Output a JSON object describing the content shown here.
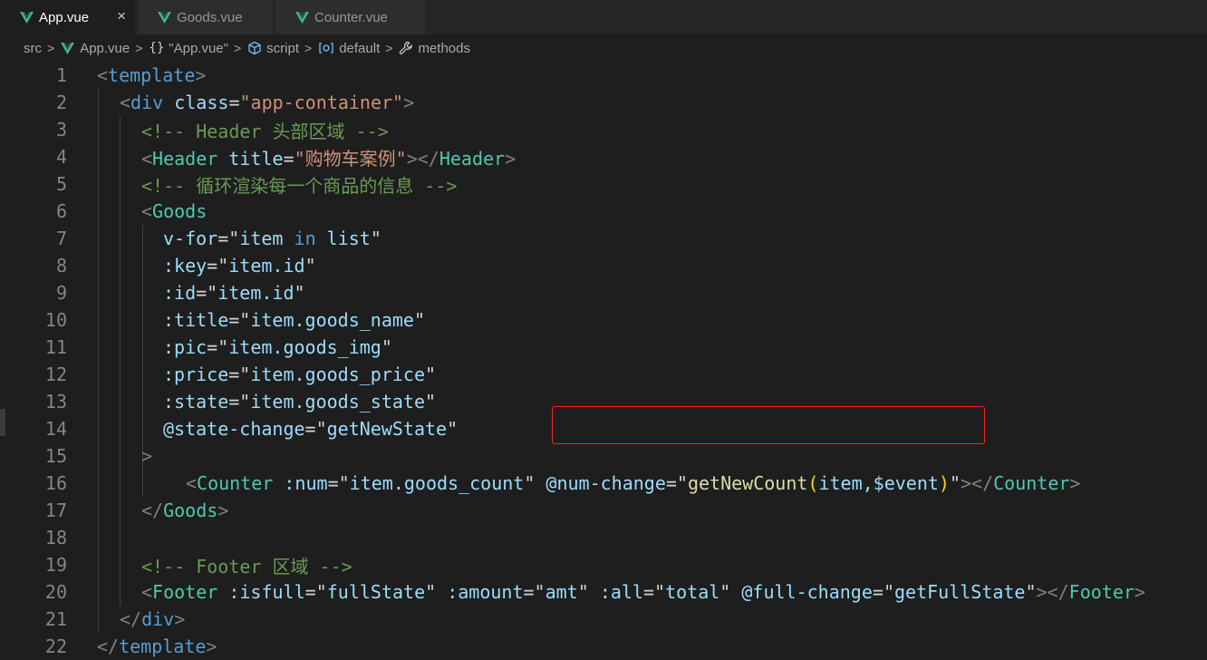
{
  "tabs": [
    {
      "label": "App.vue",
      "active": true,
      "close": "×"
    },
    {
      "label": "Goods.vue",
      "active": false
    },
    {
      "label": "Counter.vue",
      "active": false
    }
  ],
  "breadcrumb": {
    "src": "src",
    "file": "App.vue",
    "braces": "{}",
    "object": "\"App.vue\"",
    "script": "script",
    "default": "default",
    "methods": "methods"
  },
  "line_numbers": [
    "1",
    "2",
    "3",
    "4",
    "5",
    "6",
    "7",
    "8",
    "9",
    "10",
    "11",
    "12",
    "13",
    "14",
    "15",
    "16",
    "17",
    "18",
    "19",
    "20",
    "21",
    "22"
  ],
  "code": {
    "l1": {
      "open": "<",
      "tag": "template",
      "close": ">"
    },
    "l2": {
      "open": "<",
      "tag": "div",
      "attr": "class",
      "eq": "=",
      "val": "\"app-container\"",
      "close": ">"
    },
    "l3": {
      "comment": "<!-- Header 头部区域 -->"
    },
    "l4": {
      "open": "<",
      "comp": "Header",
      "attr": "title",
      "eq": "=",
      "val": "\"购物车案例\"",
      "mid": "></",
      "comp2": "Header",
      "close": ">"
    },
    "l5": {
      "comment": "<!-- 循环渲染每一个商品的信息 -->"
    },
    "l6": {
      "open": "<",
      "comp": "Goods"
    },
    "l7": {
      "attr": "v-for",
      "eq": "=",
      "q1": "\"",
      "e1": "item",
      "kw": "in",
      "e2": "list",
      "q2": "\""
    },
    "l8": {
      "attr": ":key",
      "eq": "=",
      "q1": "\"",
      "e1": "item.id",
      "q2": "\""
    },
    "l9": {
      "attr": ":id",
      "eq": "=",
      "q1": "\"",
      "e1": "item.id",
      "q2": "\""
    },
    "l10": {
      "attr": ":title",
      "eq": "=",
      "q1": "\"",
      "e1": "item.goods_name",
      "q2": "\""
    },
    "l11": {
      "attr": ":pic",
      "eq": "=",
      "q1": "\"",
      "e1": "item.goods_img",
      "q2": "\""
    },
    "l12": {
      "attr": ":price",
      "eq": "=",
      "q1": "\"",
      "e1": "item.goods_price",
      "q2": "\""
    },
    "l13": {
      "attr": ":state",
      "eq": "=",
      "q1": "\"",
      "e1": "item.goods_state",
      "q2": "\""
    },
    "l14": {
      "attr": "@state-change",
      "eq": "=",
      "q1": "\"",
      "e1": "getNewState",
      "q2": "\""
    },
    "l15": {
      "close": ">"
    },
    "l16": {
      "open": "<",
      "comp": "Counter",
      "attr1": ":num",
      "eq1": "=",
      "q1": "\"",
      "e1": "item.goods_count",
      "q2": "\"",
      "attr2": "@num-change",
      "eq2": "=",
      "q3": "\"",
      "fn": "getNewCount",
      "p1": "(",
      "e2": "item,$event",
      "p2": ")",
      "q4": "\"",
      "mid": "></",
      "comp2": "Counter",
      "close": ">"
    },
    "l17": {
      "open": "</",
      "comp": "Goods",
      "close": ">"
    },
    "l19": {
      "comment": "<!-- Footer 区域 -->"
    },
    "l20": {
      "open": "<",
      "comp": "Footer",
      "a1": ":isfull",
      "eq": "=",
      "q": "\"",
      "v1": "fullState",
      "a2": ":amount",
      "v2": "amt",
      "a3": ":all",
      "v3": "total",
      "a4": "@full-change",
      "v4": "getFullState",
      "mid": "></",
      "comp2": "Footer",
      "close": ">"
    },
    "l21": {
      "open": "</",
      "tag": "div",
      "close": ">"
    },
    "l22": {
      "open": "</",
      "tag": "template",
      "close": ">"
    }
  },
  "colors": {
    "background": "#1e1e1e",
    "tag": "#569cd6",
    "component": "#4ec9b0",
    "attribute": "#9cdcfe",
    "string": "#ce9178",
    "comment": "#6a9955",
    "function": "#dcdcaa",
    "highlight_border": "#ff2020"
  },
  "icons": [
    "vue-icon",
    "close-icon",
    "braces-icon",
    "cube-icon",
    "module-icon",
    "wrench-icon"
  ]
}
